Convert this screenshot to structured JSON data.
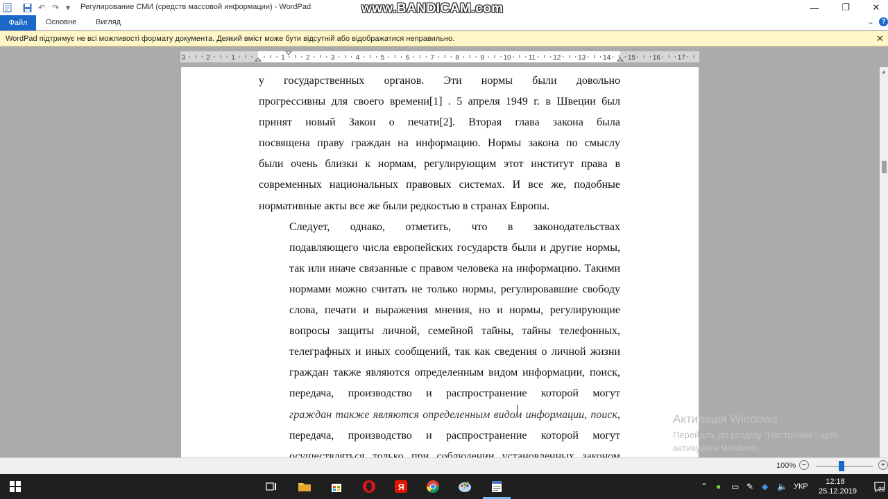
{
  "window": {
    "title": "Регулирование СМИ (средств массовой информации) - WordPad",
    "watermark": "www.BANDICAM.com",
    "minimize": "—",
    "maximize": "❐",
    "close": "✕"
  },
  "quick_access": {
    "app_icon": "wordpad-icon",
    "save_icon": "save-icon",
    "undo_icon": "undo-icon",
    "redo_icon": "redo-icon",
    "customize": "▾"
  },
  "ribbon": {
    "tabs": [
      {
        "label": "Файл"
      },
      {
        "label": "Основне"
      },
      {
        "label": "Вигляд"
      }
    ],
    "collapse": "⌄",
    "help": "?"
  },
  "infobar": {
    "message": "WordPad підтримує не всі можливості формату документа. Деякий вміст може бути відсутній або відображатися неправильно.",
    "close": "✕"
  },
  "ruler": {
    "labels": [
      "3",
      "2",
      "1",
      "1",
      "2",
      "3",
      "4",
      "5",
      "6",
      "7",
      "8",
      "9",
      "10",
      "11",
      "12",
      "13",
      "14",
      "15",
      "16",
      "17"
    ]
  },
  "document": {
    "paragraph1": [
      "у государственных органов. Эти нормы были довольно",
      "прогрессивны для своего времени[1] . 5 апреля 1949 г. в Швеции был",
      "принят новый Закон о печати[2]. Вторая глава закона была",
      "посвящена праву граждан на информацию. Нормы закона по смыслу",
      "были очень близки к нормам, регулирующим этот институт права в",
      "современных национальных правовых системах. И все же, подобные",
      "нормативные акты все же были редкостью в странах Европы."
    ],
    "paragraph2": [
      "Следует, однако, отметить, что в законодательствах",
      "подавляющего числа европейских государств были и другие нормы,",
      "так или иначе связанные с правом человека на информацию. Такими",
      "нормами можно считать не только нормы, регулировавшие свободу",
      "слова, печати и выражения мнения, но и нормы, регулирующие",
      "вопросы защиты личной, семейной тайны, тайны телефонных,",
      "телеграфных и иных сообщений, так как сведения о личной жизни",
      "граждан также являются определенным видом информации, поиск,",
      "передача, производство и распространение которой могут",
      "граждан также являются определенным видом информации, поиск,",
      "передача, производство и распространение которой могут",
      "осуществляться только при соблюдении установленных законом"
    ]
  },
  "statusbar": {
    "zoom": "100%",
    "zoom_out": "−",
    "zoom_in": "+",
    "zoom_level_fraction": 0.45
  },
  "activation": {
    "title": "Активація Windows",
    "subtitle": "Перейдіть до розділу \"Настройки\", щоб активувати Windows."
  },
  "taskbar": {
    "language": "УКР",
    "time": "12:18",
    "date": "25.12.2019",
    "notifications": "22"
  }
}
